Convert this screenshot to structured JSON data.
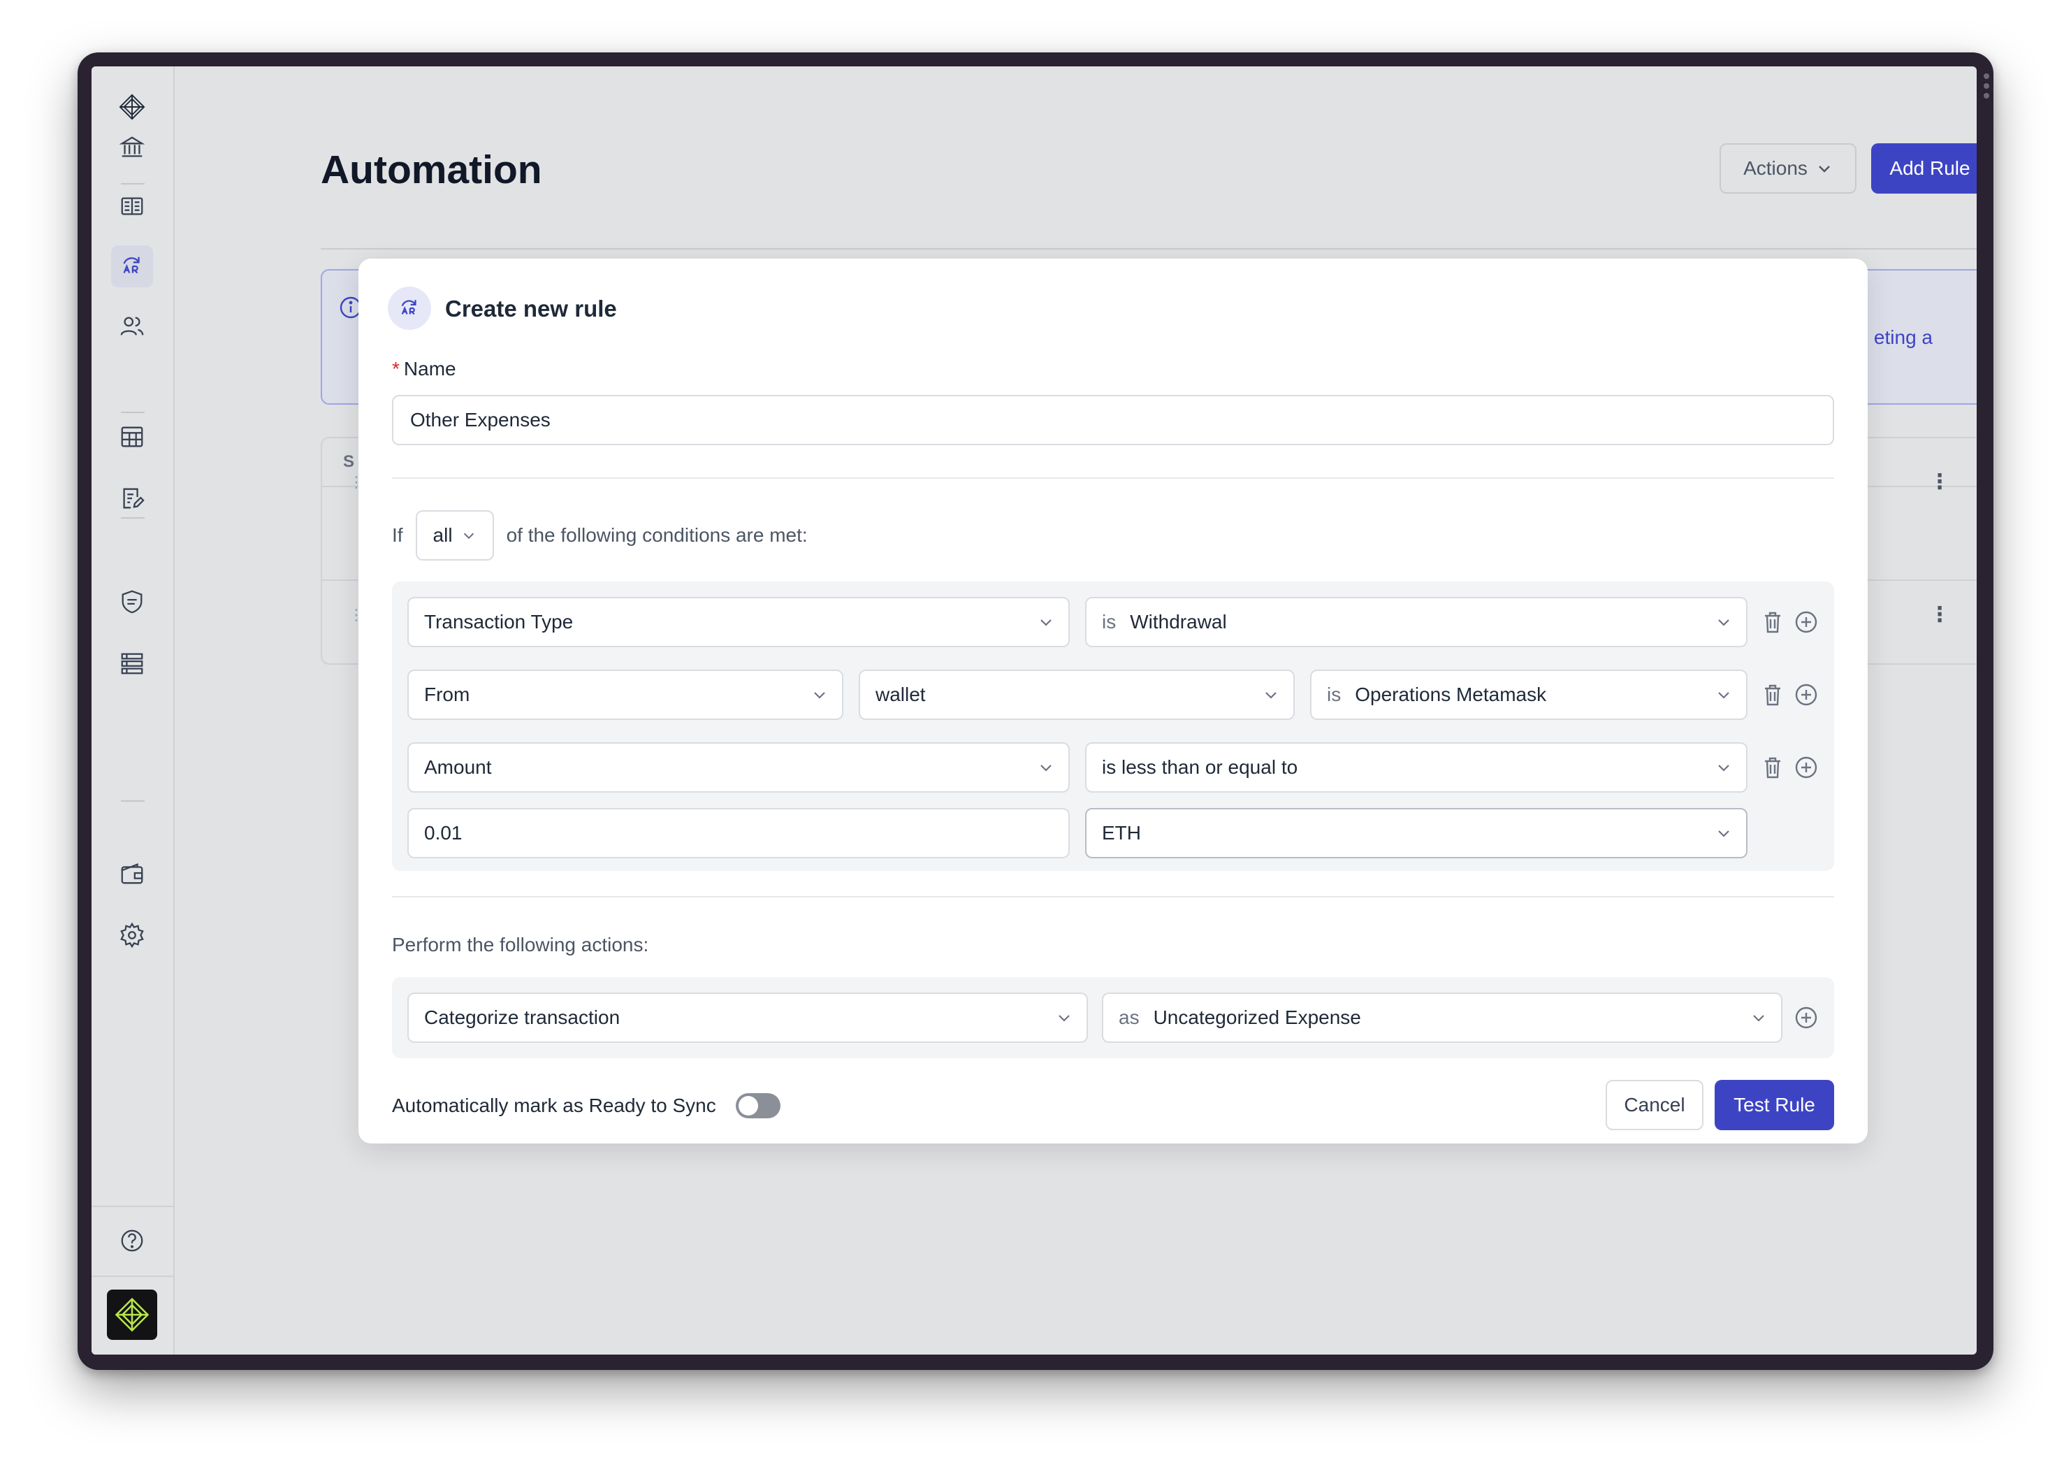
{
  "page": {
    "title": "Automation",
    "actions_label": "Actions",
    "add_rule_label": "Add Rule"
  },
  "background": {
    "banner_text_fragment": "eting a",
    "table_header_fragment": "S"
  },
  "modal": {
    "title": "Create new rule",
    "name_label": "Name",
    "name_value": "Other Expenses",
    "conditions_prefix": "If",
    "match_mode": "all",
    "conditions_suffix": "of the following conditions are met:",
    "conditions": [
      {
        "field": "Transaction Type",
        "operator_prefix": "is",
        "value": "Withdrawal"
      },
      {
        "field": "From",
        "sub_field": "wallet",
        "operator_prefix": "is",
        "value": "Operations Metamask"
      },
      {
        "field": "Amount",
        "operator": "is less than or equal to",
        "amount": "0.01",
        "currency": "ETH"
      }
    ],
    "actions_heading": "Perform the following actions:",
    "action": {
      "type": "Categorize transaction",
      "prefix": "as",
      "value": "Uncategorized Expense"
    },
    "auto_sync_label": "Automatically mark as Ready to Sync",
    "auto_sync_enabled": false,
    "cancel_label": "Cancel",
    "test_label": "Test Rule"
  },
  "colors": {
    "primary": "#3d44c4",
    "required": "#dc2626",
    "toggle_off": "#8a8f98"
  },
  "icons": {
    "sidebar": [
      "logo-icon",
      "bank-icon",
      "ledger-icon",
      "automation-icon",
      "users-icon",
      "table-icon",
      "edit-report-icon",
      "shield-icon",
      "layers-icon",
      "wallet-icon",
      "gear-icon",
      "help-icon",
      "app-logo-icon"
    ],
    "row_actions": [
      "trash-icon",
      "plus-circle-icon"
    ]
  }
}
